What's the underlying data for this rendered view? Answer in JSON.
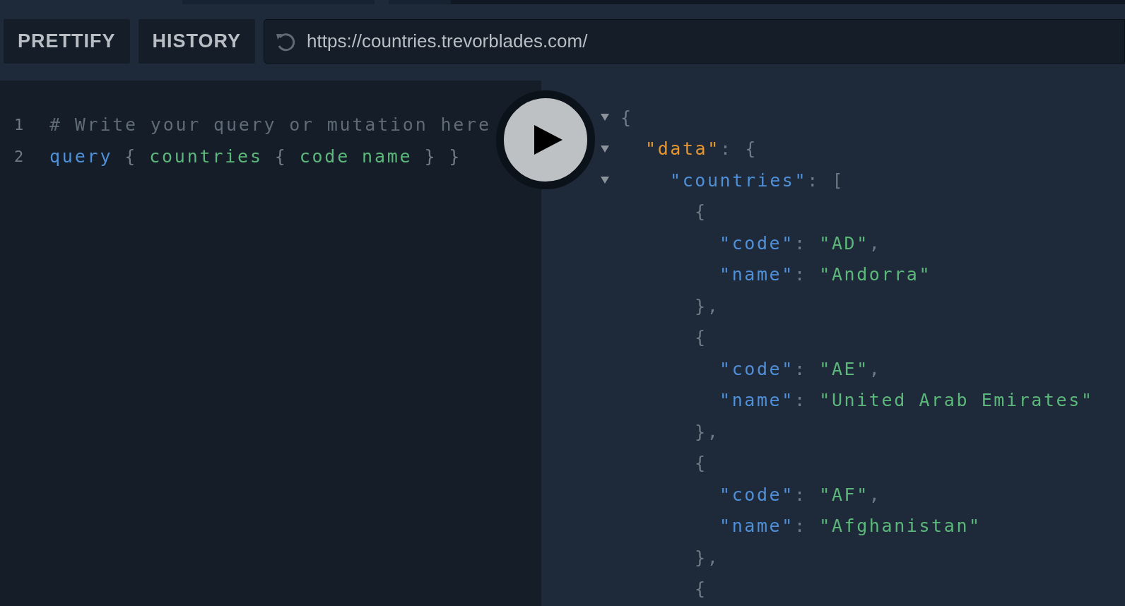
{
  "toolbar": {
    "buttons": [
      "PRETTIFY",
      "HISTORY"
    ],
    "endpoint": "https://countries.trevorblades.com/"
  },
  "editor": {
    "lines": [
      {
        "number": "1",
        "tokens": [
          {
            "kind": "comment",
            "text": "# Write your query or mutation here"
          }
        ]
      },
      {
        "number": "2",
        "tokens": [
          {
            "kind": "keyword",
            "text": "query"
          },
          {
            "kind": "punct",
            "text": "{"
          },
          {
            "kind": "field",
            "text": "countries"
          },
          {
            "kind": "punct",
            "text": "{"
          },
          {
            "kind": "field",
            "text": "code"
          },
          {
            "kind": "field",
            "text": "name"
          },
          {
            "kind": "punct",
            "text": "}"
          },
          {
            "kind": "punct",
            "text": "}"
          }
        ]
      }
    ]
  },
  "result": [
    {
      "expanded": true,
      "tokens": [
        {
          "kind": "punct",
          "text": "{"
        }
      ],
      "children": [
        {
          "expanded": true,
          "tokens": [
            {
              "kind": "root_key",
              "text": "\"data\""
            },
            {
              "kind": "punct",
              "text": ": {"
            }
          ],
          "children": [
            {
              "expanded": true,
              "tokens": [
                {
                  "kind": "key",
                  "text": "\"countries\""
                },
                {
                  "kind": "punct",
                  "text": ": ["
                }
              ],
              "children": [
                {
                  "tokens": [
                    {
                      "kind": "punct",
                      "text": "{"
                    }
                  ],
                  "children": [
                    {
                      "tokens": [
                        {
                          "kind": "key",
                          "text": "\"code\""
                        },
                        {
                          "kind": "punct",
                          "text": ": "
                        },
                        {
                          "kind": "string",
                          "text": "\"AD\""
                        },
                        {
                          "kind": "punct",
                          "text": ","
                        }
                      ]
                    },
                    {
                      "tokens": [
                        {
                          "kind": "key",
                          "text": "\"name\""
                        },
                        {
                          "kind": "punct",
                          "text": ": "
                        },
                        {
                          "kind": "string",
                          "text": "\"Andorra\""
                        }
                      ]
                    }
                  ]
                },
                {
                  "tokens": [
                    {
                      "kind": "punct",
                      "text": "},"
                    }
                  ]
                },
                {
                  "tokens": [
                    {
                      "kind": "punct",
                      "text": "{"
                    }
                  ],
                  "children": [
                    {
                      "tokens": [
                        {
                          "kind": "key",
                          "text": "\"code\""
                        },
                        {
                          "kind": "punct",
                          "text": ": "
                        },
                        {
                          "kind": "string",
                          "text": "\"AE\""
                        },
                        {
                          "kind": "punct",
                          "text": ","
                        }
                      ]
                    },
                    {
                      "tokens": [
                        {
                          "kind": "key",
                          "text": "\"name\""
                        },
                        {
                          "kind": "punct",
                          "text": ": "
                        },
                        {
                          "kind": "string",
                          "text": "\"United Arab Emirates\""
                        }
                      ]
                    }
                  ]
                },
                {
                  "tokens": [
                    {
                      "kind": "punct",
                      "text": "},"
                    }
                  ]
                },
                {
                  "tokens": [
                    {
                      "kind": "punct",
                      "text": "{"
                    }
                  ],
                  "children": [
                    {
                      "tokens": [
                        {
                          "kind": "key",
                          "text": "\"code\""
                        },
                        {
                          "kind": "punct",
                          "text": ": "
                        },
                        {
                          "kind": "string",
                          "text": "\"AF\""
                        },
                        {
                          "kind": "punct",
                          "text": ","
                        }
                      ]
                    },
                    {
                      "tokens": [
                        {
                          "kind": "key",
                          "text": "\"name\""
                        },
                        {
                          "kind": "punct",
                          "text": ": "
                        },
                        {
                          "kind": "string",
                          "text": "\"Afghanistan\""
                        }
                      ]
                    }
                  ]
                },
                {
                  "tokens": [
                    {
                      "kind": "punct",
                      "text": "},"
                    }
                  ]
                },
                {
                  "tokens": [
                    {
                      "kind": "punct",
                      "text": "{"
                    }
                  ]
                }
              ]
            }
          ]
        }
      ]
    }
  ]
}
